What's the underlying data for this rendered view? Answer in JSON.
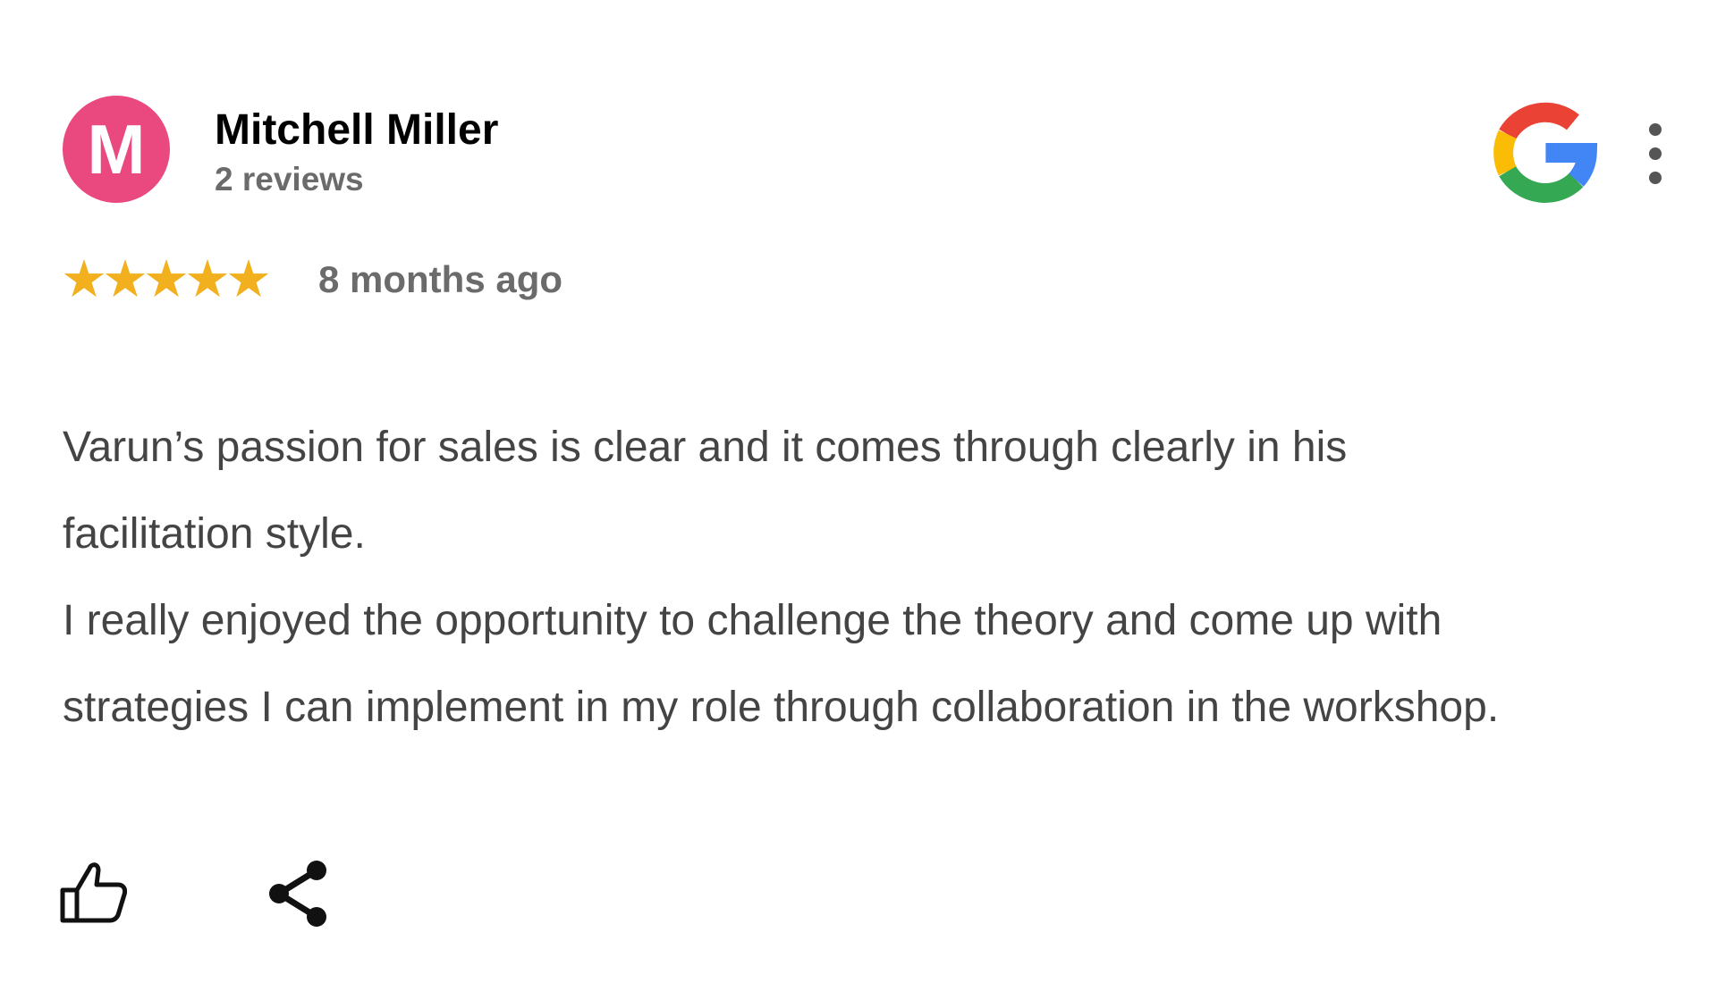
{
  "reviewer": {
    "initial": "M",
    "name": "Mitchell Miller",
    "review_count": "2 reviews",
    "avatar_color": "#e9497e"
  },
  "source": {
    "logo_icon": "google-g-icon",
    "menu_icon": "more-vertical-icon"
  },
  "rating": {
    "stars": 5,
    "max": 5,
    "star_color": "#f2b01e",
    "time_ago": "8 months ago"
  },
  "review": {
    "paragraphs": [
      {
        "lines": [
          "Varun’s passion for sales is clear and it comes through clearly in his",
          "facilitation style."
        ]
      },
      {
        "lines": [
          "I really enjoyed the opportunity to challenge the theory and come up with",
          "strategies I can implement in my role through collaboration in the workshop."
        ]
      }
    ]
  },
  "actions": {
    "like_icon": "thumbs-up-icon",
    "share_icon": "share-icon"
  }
}
